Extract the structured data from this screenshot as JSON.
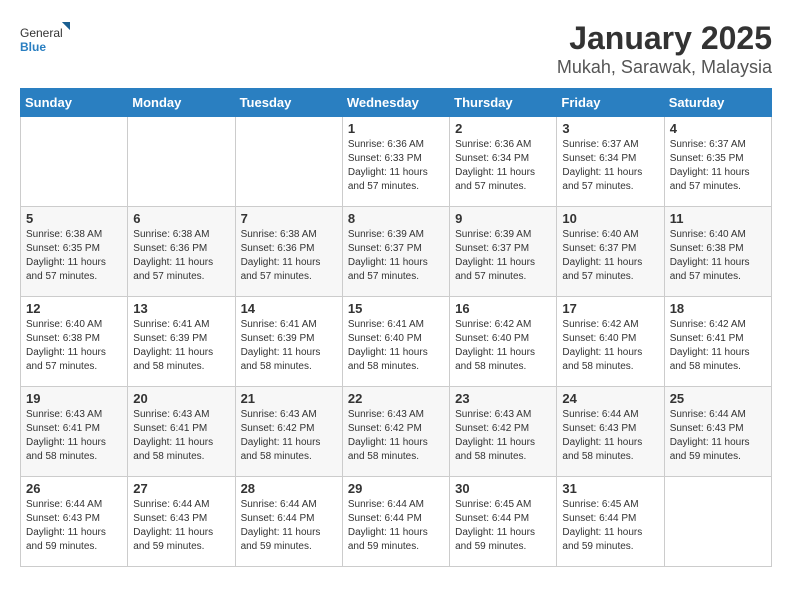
{
  "header": {
    "logo": {
      "general": "General",
      "blue": "Blue"
    },
    "title": "January 2025",
    "subtitle": "Mukah, Sarawak, Malaysia"
  },
  "calendar": {
    "weekdays": [
      "Sunday",
      "Monday",
      "Tuesday",
      "Wednesday",
      "Thursday",
      "Friday",
      "Saturday"
    ],
    "weeks": [
      [
        {
          "day": "",
          "info": ""
        },
        {
          "day": "",
          "info": ""
        },
        {
          "day": "",
          "info": ""
        },
        {
          "day": "1",
          "info": "Sunrise: 6:36 AM\nSunset: 6:33 PM\nDaylight: 11 hours\nand 57 minutes."
        },
        {
          "day": "2",
          "info": "Sunrise: 6:36 AM\nSunset: 6:34 PM\nDaylight: 11 hours\nand 57 minutes."
        },
        {
          "day": "3",
          "info": "Sunrise: 6:37 AM\nSunset: 6:34 PM\nDaylight: 11 hours\nand 57 minutes."
        },
        {
          "day": "4",
          "info": "Sunrise: 6:37 AM\nSunset: 6:35 PM\nDaylight: 11 hours\nand 57 minutes."
        }
      ],
      [
        {
          "day": "5",
          "info": "Sunrise: 6:38 AM\nSunset: 6:35 PM\nDaylight: 11 hours\nand 57 minutes."
        },
        {
          "day": "6",
          "info": "Sunrise: 6:38 AM\nSunset: 6:36 PM\nDaylight: 11 hours\nand 57 minutes."
        },
        {
          "day": "7",
          "info": "Sunrise: 6:38 AM\nSunset: 6:36 PM\nDaylight: 11 hours\nand 57 minutes."
        },
        {
          "day": "8",
          "info": "Sunrise: 6:39 AM\nSunset: 6:37 PM\nDaylight: 11 hours\nand 57 minutes."
        },
        {
          "day": "9",
          "info": "Sunrise: 6:39 AM\nSunset: 6:37 PM\nDaylight: 11 hours\nand 57 minutes."
        },
        {
          "day": "10",
          "info": "Sunrise: 6:40 AM\nSunset: 6:37 PM\nDaylight: 11 hours\nand 57 minutes."
        },
        {
          "day": "11",
          "info": "Sunrise: 6:40 AM\nSunset: 6:38 PM\nDaylight: 11 hours\nand 57 minutes."
        }
      ],
      [
        {
          "day": "12",
          "info": "Sunrise: 6:40 AM\nSunset: 6:38 PM\nDaylight: 11 hours\nand 57 minutes."
        },
        {
          "day": "13",
          "info": "Sunrise: 6:41 AM\nSunset: 6:39 PM\nDaylight: 11 hours\nand 58 minutes."
        },
        {
          "day": "14",
          "info": "Sunrise: 6:41 AM\nSunset: 6:39 PM\nDaylight: 11 hours\nand 58 minutes."
        },
        {
          "day": "15",
          "info": "Sunrise: 6:41 AM\nSunset: 6:40 PM\nDaylight: 11 hours\nand 58 minutes."
        },
        {
          "day": "16",
          "info": "Sunrise: 6:42 AM\nSunset: 6:40 PM\nDaylight: 11 hours\nand 58 minutes."
        },
        {
          "day": "17",
          "info": "Sunrise: 6:42 AM\nSunset: 6:40 PM\nDaylight: 11 hours\nand 58 minutes."
        },
        {
          "day": "18",
          "info": "Sunrise: 6:42 AM\nSunset: 6:41 PM\nDaylight: 11 hours\nand 58 minutes."
        }
      ],
      [
        {
          "day": "19",
          "info": "Sunrise: 6:43 AM\nSunset: 6:41 PM\nDaylight: 11 hours\nand 58 minutes."
        },
        {
          "day": "20",
          "info": "Sunrise: 6:43 AM\nSunset: 6:41 PM\nDaylight: 11 hours\nand 58 minutes."
        },
        {
          "day": "21",
          "info": "Sunrise: 6:43 AM\nSunset: 6:42 PM\nDaylight: 11 hours\nand 58 minutes."
        },
        {
          "day": "22",
          "info": "Sunrise: 6:43 AM\nSunset: 6:42 PM\nDaylight: 11 hours\nand 58 minutes."
        },
        {
          "day": "23",
          "info": "Sunrise: 6:43 AM\nSunset: 6:42 PM\nDaylight: 11 hours\nand 58 minutes."
        },
        {
          "day": "24",
          "info": "Sunrise: 6:44 AM\nSunset: 6:43 PM\nDaylight: 11 hours\nand 58 minutes."
        },
        {
          "day": "25",
          "info": "Sunrise: 6:44 AM\nSunset: 6:43 PM\nDaylight: 11 hours\nand 59 minutes."
        }
      ],
      [
        {
          "day": "26",
          "info": "Sunrise: 6:44 AM\nSunset: 6:43 PM\nDaylight: 11 hours\nand 59 minutes."
        },
        {
          "day": "27",
          "info": "Sunrise: 6:44 AM\nSunset: 6:43 PM\nDaylight: 11 hours\nand 59 minutes."
        },
        {
          "day": "28",
          "info": "Sunrise: 6:44 AM\nSunset: 6:44 PM\nDaylight: 11 hours\nand 59 minutes."
        },
        {
          "day": "29",
          "info": "Sunrise: 6:44 AM\nSunset: 6:44 PM\nDaylight: 11 hours\nand 59 minutes."
        },
        {
          "day": "30",
          "info": "Sunrise: 6:45 AM\nSunset: 6:44 PM\nDaylight: 11 hours\nand 59 minutes."
        },
        {
          "day": "31",
          "info": "Sunrise: 6:45 AM\nSunset: 6:44 PM\nDaylight: 11 hours\nand 59 minutes."
        },
        {
          "day": "",
          "info": ""
        }
      ]
    ]
  }
}
